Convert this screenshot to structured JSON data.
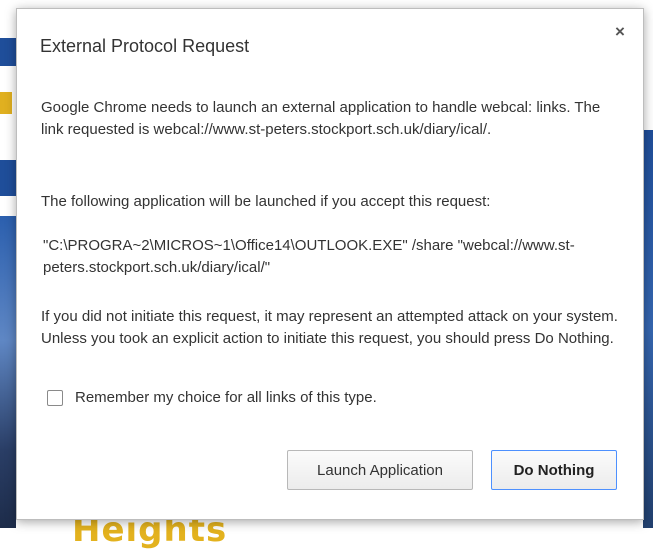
{
  "background": {
    "partial_text": "Heights"
  },
  "dialog": {
    "title": "External Protocol Request",
    "close_label": "×",
    "paragraph1": "Google Chrome needs to launch an external application to handle webcal: links. The link requested is webcal://www.st-peters.stockport.sch.uk/diary/ical/.",
    "paragraph2": "The following application will be launched if you accept this request:",
    "command_line": "\"C:\\PROGRA~2\\MICROS~1\\Office14\\OUTLOOK.EXE\" /share \"webcal://www.st-peters.stockport.sch.uk/diary/ical/\"",
    "paragraph3": "If you did not initiate this request, it may represent an attempted attack on your system. Unless you took an explicit action to initiate this request, you should press Do Nothing.",
    "remember_label": "Remember my choice for all links of this type.",
    "remember_checked": false,
    "launch_button": "Launch Application",
    "do_nothing_button": "Do Nothing"
  },
  "colors": {
    "focus_border": "#4d90fe",
    "background_blue": "#1f4e9a",
    "background_yellow": "#e3b21e"
  }
}
